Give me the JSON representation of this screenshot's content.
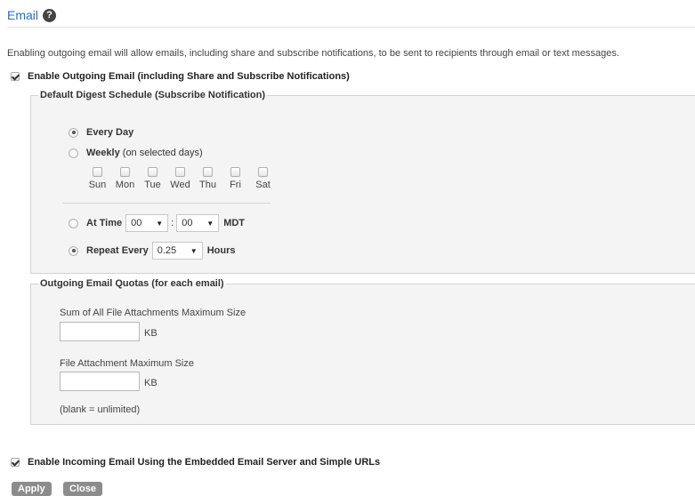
{
  "header": {
    "title": "Email",
    "help_icon": "?"
  },
  "description": "Enabling outgoing email will allow emails, including share and subscribe notifications, to be sent to recipients through email or text messages.",
  "outgoing": {
    "enable_label": "Enable Outgoing Email (including Share and Subscribe Notifications)",
    "enabled": true
  },
  "digest": {
    "legend": "Default Digest Schedule (Subscribe Notification)",
    "every_day_label": "Every Day",
    "every_day_selected": true,
    "weekly_label": "Weekly",
    "weekly_suffix": "(on selected days)",
    "weekly_selected": false,
    "days": [
      "Sun",
      "Mon",
      "Tue",
      "Wed",
      "Thu",
      "Fri",
      "Sat"
    ],
    "at_time_label": "At Time",
    "at_time_selected": false,
    "hour": "00",
    "minute": "00",
    "time_sep": ":",
    "timezone": "MDT",
    "repeat_label": "Repeat Every",
    "repeat_selected": true,
    "repeat_value": "0.25",
    "repeat_unit": "Hours"
  },
  "quotas": {
    "legend": "Outgoing Email Quotas (for each email)",
    "total_label": "Sum of All File Attachments Maximum Size",
    "total_value": "",
    "total_unit": "KB",
    "single_label": "File Attachment Maximum Size",
    "single_value": "",
    "single_unit": "KB",
    "note": "(blank = unlimited)"
  },
  "incoming": {
    "enable_label": "Enable Incoming Email Using the Embedded Email Server and Simple URLs",
    "enabled": true
  },
  "buttons": {
    "apply": "Apply",
    "close": "Close"
  },
  "colors": {
    "title": "#2a6ebb",
    "panel_bg": "#f4f4f4",
    "button_bg": "#8c8c8c"
  }
}
